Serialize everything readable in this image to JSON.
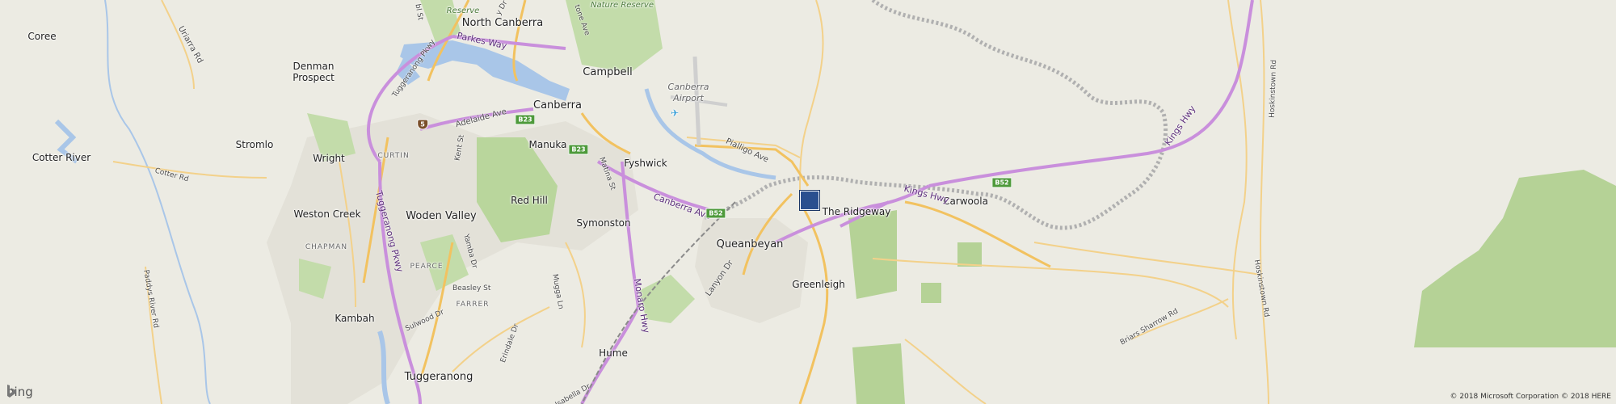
{
  "map": {
    "places": [
      {
        "id": "north-canberra",
        "text": "North Canberra"
      },
      {
        "id": "campbell",
        "text": "Campbell"
      },
      {
        "id": "canberra",
        "text": "Canberra"
      },
      {
        "id": "coree",
        "text": "Coree"
      },
      {
        "id": "denman-prospect",
        "text": "Denman\nProspect"
      },
      {
        "id": "stromlo",
        "text": "Stromlo"
      },
      {
        "id": "cotter-river",
        "text": "Cotter River"
      },
      {
        "id": "wright",
        "text": "Wright"
      },
      {
        "id": "weston-creek",
        "text": "Weston Creek"
      },
      {
        "id": "woden-valley",
        "text": "Woden Valley"
      },
      {
        "id": "manuka",
        "text": "Manuka"
      },
      {
        "id": "red-hill",
        "text": "Red Hill"
      },
      {
        "id": "fyshwick",
        "text": "Fyshwick"
      },
      {
        "id": "symonston",
        "text": "Symonston"
      },
      {
        "id": "queanbeyan",
        "text": "Queanbeyan"
      },
      {
        "id": "greenleigh",
        "text": "Greenleigh"
      },
      {
        "id": "the-ridgeway",
        "text": "The Ridgeway"
      },
      {
        "id": "carwoola",
        "text": "Carwoola"
      },
      {
        "id": "kambah",
        "text": "Kambah"
      },
      {
        "id": "tuggeranong",
        "text": "Tuggeranong"
      },
      {
        "id": "hume",
        "text": "Hume"
      }
    ],
    "suburbs": [
      {
        "id": "curtin",
        "text": "CURTIN"
      },
      {
        "id": "chapman",
        "text": "CHAPMAN"
      },
      {
        "id": "pearce",
        "text": "PEARCE"
      },
      {
        "id": "farrer",
        "text": "FARRER"
      }
    ],
    "water": [
      {
        "id": "lake-burley-griffin",
        "text": ""
      }
    ],
    "nature": [
      {
        "id": "reserve-1",
        "text": "Reserve"
      },
      {
        "id": "nature-reserve-2",
        "text": "Nature Reserve"
      }
    ],
    "airport": "Canberra\nAirport",
    "roads": [
      {
        "id": "parkes-way",
        "text": "Parkes Way"
      },
      {
        "id": "tuggeranong-pkwy-top",
        "text": "Tuggeranong Pkwy"
      },
      {
        "id": "tuggeranong-pkwy",
        "text": "Tuggeranong Pkwy"
      },
      {
        "id": "adelaide-ave",
        "text": "Adelaide Ave"
      },
      {
        "id": "canberra-ave",
        "text": "Canberra Ave"
      },
      {
        "id": "monaro-hwy",
        "text": "Monaro Hwy"
      },
      {
        "id": "kings-hwy-1",
        "text": "Kings Hwy"
      },
      {
        "id": "kings-hwy-2",
        "text": "Kings Hwy"
      },
      {
        "id": "pialligo-ave",
        "text": "Pialligo Ave"
      },
      {
        "id": "lanyon-dr",
        "text": "Lanyon Dr"
      },
      {
        "id": "uriarra-rd",
        "text": "Uriarra Rd"
      },
      {
        "id": "cotter-rd",
        "text": "Cotter Rd"
      },
      {
        "id": "kent-st",
        "text": "Kent St"
      },
      {
        "id": "mugga-ln",
        "text": "Mugga Ln"
      },
      {
        "id": "yamba-dr",
        "text": "Yamba Dr"
      },
      {
        "id": "beasley-st",
        "text": "Beasley St"
      },
      {
        "id": "sulwood-dr",
        "text": "Sulwood Dr"
      },
      {
        "id": "erindale-dr",
        "text": "Erindale Dr"
      },
      {
        "id": "matina-st",
        "text": "Matina St"
      },
      {
        "id": "paddys-river-rd",
        "text": "Paddys River Rd"
      },
      {
        "id": "hoskinstown-rd-1",
        "text": "Hoskinstown Rd"
      },
      {
        "id": "hoskinstown-rd-2",
        "text": "Hoskinstown Rd"
      },
      {
        "id": "briars-sharrow-rd",
        "text": "Briars Sharrow Rd"
      },
      {
        "id": "isabella-dr",
        "text": "Isabella Dr"
      },
      {
        "id": "blackall-st",
        "text": "bl St"
      },
      {
        "id": "limestone-ave",
        "text": "tone Ave"
      },
      {
        "id": "dr-top",
        "text": "y Dr"
      }
    ],
    "shields": [
      {
        "id": "b23-a",
        "text": "B23"
      },
      {
        "id": "b23-b",
        "text": "B23"
      },
      {
        "id": "b52-a",
        "text": "B52"
      },
      {
        "id": "b52-b",
        "text": "B52"
      },
      {
        "id": "route-5",
        "text": "5"
      }
    ],
    "pin_label": "location-marker"
  },
  "branding": {
    "logo": "bing",
    "copyright": "© 2018 Microsoft Corporation © 2018 HERE"
  },
  "colors": {
    "background": "#ecebe3",
    "water": "#a9c6e8",
    "park": "#b7d49a",
    "major_road": "#c78fd8",
    "arterial_road": "#f5c96a",
    "pin": "#2a4f8f"
  }
}
